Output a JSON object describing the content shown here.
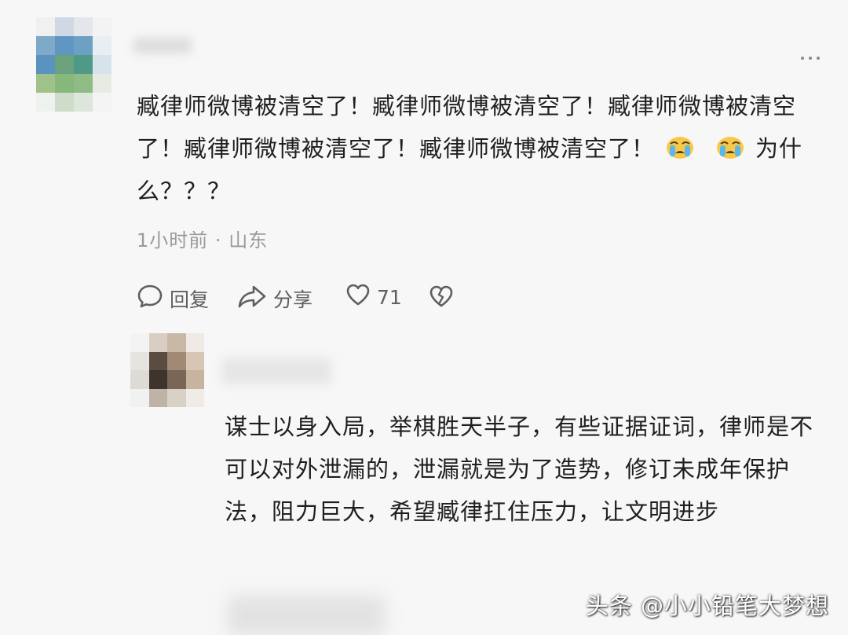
{
  "comment": {
    "text_part1": "臧律师微博被清空了！臧律师微博被清空了！臧律师微博被清空了！臧律师微博被清空了！臧律师微博被清空了！",
    "emoji_icon": "loudly-crying-face-icon",
    "text_part2": "为什么？？？",
    "time": "1小时前",
    "separator": "·",
    "location": "山东"
  },
  "actions": {
    "reply_label": "回复",
    "share_label": "分享",
    "like_count": "71"
  },
  "reply": {
    "text": "谋士以身入局，举棋胜天半子，有些证据证词，律师是不可以对外泄漏的，泄漏就是为了造势，修订未成年保护法，阻力巨大，希望臧律扛住压力，让文明进步"
  },
  "watermark": "头条 @小小铅笔大梦想",
  "colors": {
    "background": "#f7f7f7",
    "text": "#1f1f1f",
    "meta": "#9a9a9a",
    "action": "#5f5f5f",
    "emoji_face": "#f6c94a"
  }
}
